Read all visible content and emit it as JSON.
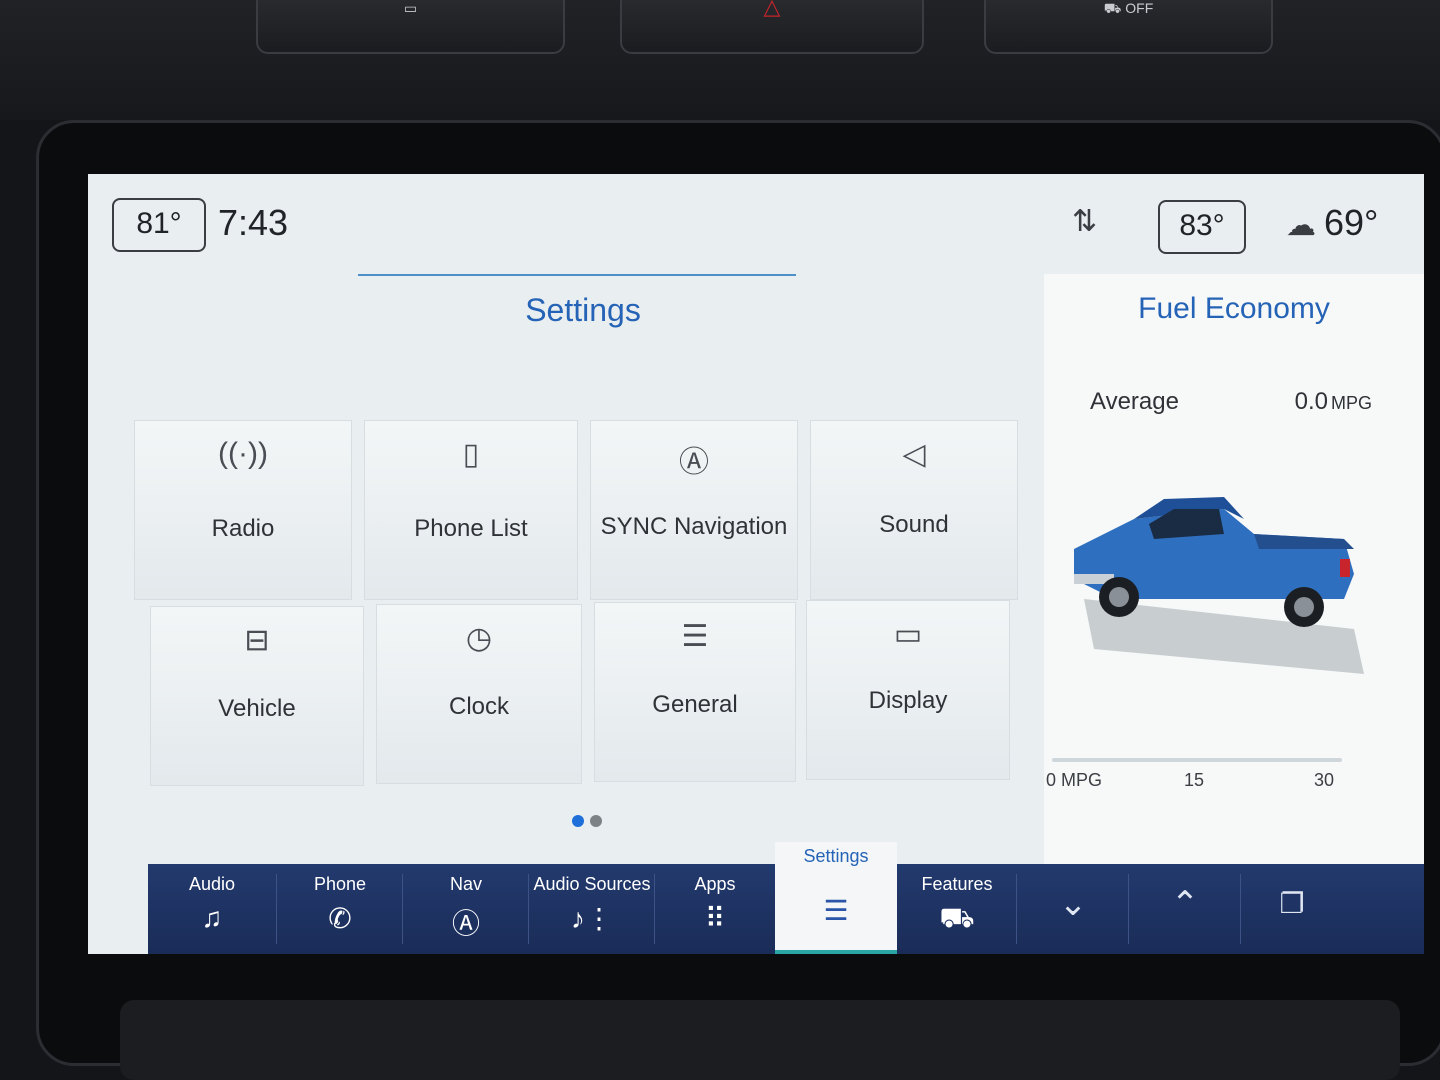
{
  "status": {
    "left_temp": "81°",
    "time": "7:43",
    "right_temp": "83°",
    "outside_temp": "69°"
  },
  "settings": {
    "title": "Settings",
    "tiles": [
      {
        "label": "Radio",
        "icon": "radio-antenna-icon"
      },
      {
        "label": "Phone List",
        "icon": "phone-list-icon"
      },
      {
        "label": "SYNC Navigation",
        "icon": "navigation-arrow-icon"
      },
      {
        "label": "Sound",
        "icon": "speaker-icon"
      },
      {
        "label": "Vehicle",
        "icon": "vehicle-settings-icon"
      },
      {
        "label": "Clock",
        "icon": "clock-icon"
      },
      {
        "label": "General",
        "icon": "sliders-icon"
      },
      {
        "label": "Display",
        "icon": "display-icon"
      }
    ],
    "page_count": 2,
    "current_page": 1
  },
  "fuel_economy": {
    "title": "Fuel Economy",
    "average_label": "Average",
    "average_value": "0.0",
    "average_unit": "MPG",
    "scale": [
      "0 MPG",
      "15",
      "30"
    ],
    "average_mpg": 0.0
  },
  "nav": {
    "items": [
      {
        "label": "Audio",
        "icon": "music-note-icon"
      },
      {
        "label": "Phone",
        "icon": "phone-icon"
      },
      {
        "label": "Nav",
        "icon": "navigation-icon"
      },
      {
        "label": "Audio Sources",
        "icon": "audio-sources-icon"
      },
      {
        "label": "Apps",
        "icon": "apps-grid-icon"
      },
      {
        "label": "Settings",
        "icon": "settings-sliders-icon",
        "active": true
      },
      {
        "label": "Features",
        "icon": "truck-icon"
      }
    ]
  },
  "colors": {
    "accent_blue": "#2563b6",
    "nav_background": "#1f3262",
    "active_teal": "#2aa6a6"
  }
}
